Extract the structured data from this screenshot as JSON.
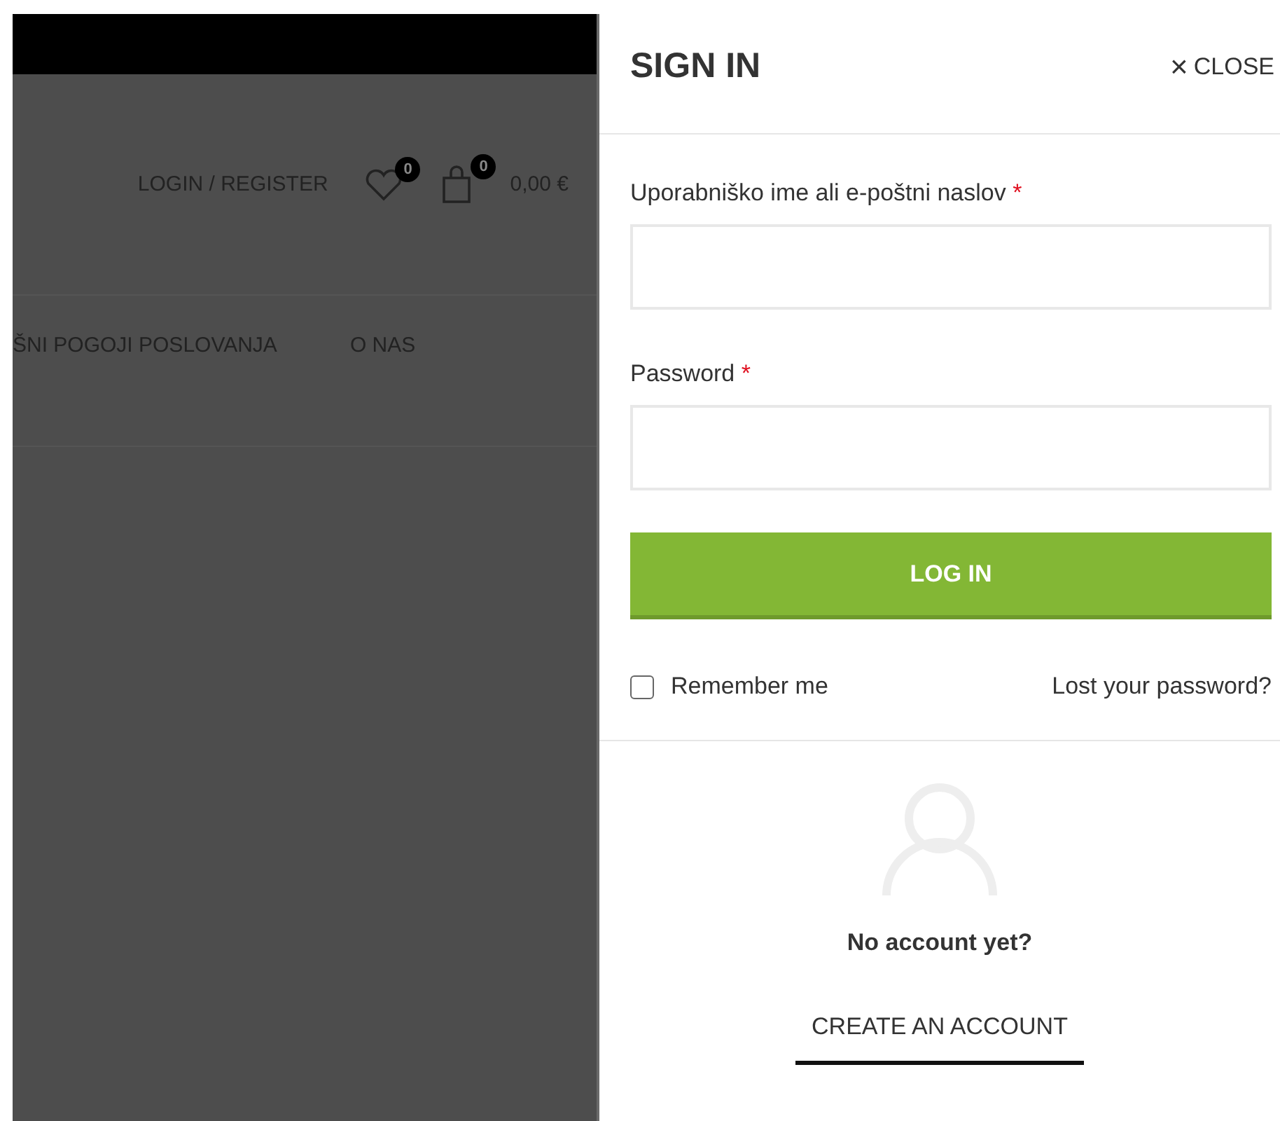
{
  "background_page": {
    "header_links": [
      {
        "kind": "text",
        "label": "LOGIN / REGISTER"
      },
      {
        "kind": "wishlist",
        "count": "0"
      },
      {
        "kind": "cart",
        "count": "0",
        "amount": "0,00 €"
      }
    ],
    "nav": [
      {
        "label": "ŠNI POGOJI POSLOVANJA"
      },
      {
        "label": "O NAS"
      }
    ]
  },
  "panel": {
    "title": "SIGN IN",
    "close": {
      "icon": "×",
      "label": "CLOSE"
    },
    "fields": [
      {
        "label": "Uporabniško ime ali e-poštni naslov",
        "required_mark": "*"
      },
      {
        "label": "Password",
        "required_mark": "*"
      }
    ],
    "submit": "LOG IN",
    "remember": {
      "label": "Remember me",
      "checked": false
    },
    "lost_password": "Lost your password?",
    "no_account": "No account yet?",
    "create_account": "CREATE AN ACCOUNT"
  }
}
